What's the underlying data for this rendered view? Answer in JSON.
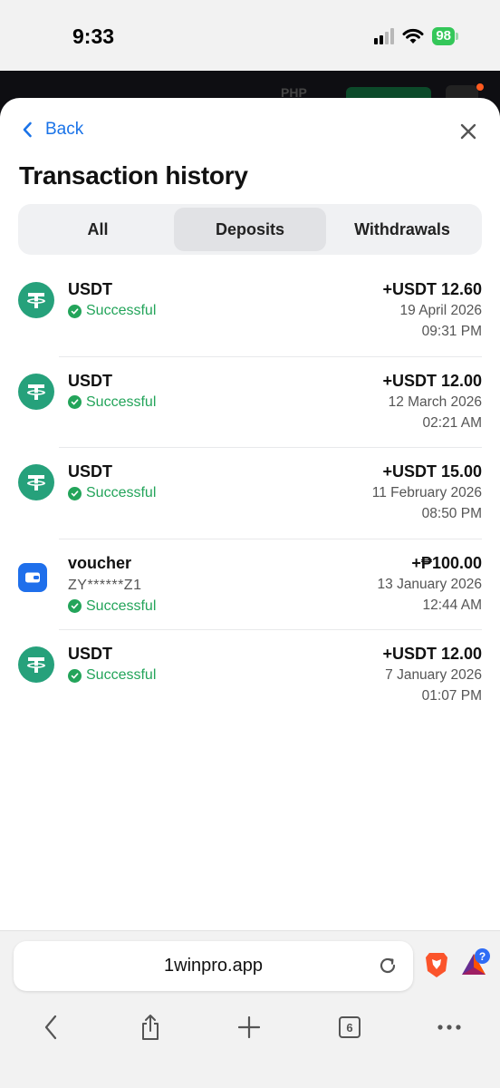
{
  "status_bar": {
    "time": "9:33",
    "battery": "98"
  },
  "backdrop": {
    "currency": "PHP"
  },
  "header": {
    "back_label": "Back",
    "title": "Transaction history"
  },
  "tabs": [
    {
      "label": "All",
      "active": false
    },
    {
      "label": "Deposits",
      "active": true
    },
    {
      "label": "Withdrawals",
      "active": false
    }
  ],
  "transactions": [
    {
      "name": "USDT",
      "icon": "tether-icon",
      "status": "Successful",
      "amount": "+USDT 12.60",
      "date": "19 April 2026",
      "time": "09:31 PM"
    },
    {
      "name": "USDT",
      "icon": "tether-icon",
      "status": "Successful",
      "amount": "+USDT 12.00",
      "date": "12 March 2026",
      "time": "02:21 AM"
    },
    {
      "name": "USDT",
      "icon": "tether-icon",
      "status": "Successful",
      "amount": "+USDT 15.00",
      "date": "11 February 2026",
      "time": "08:50 PM"
    },
    {
      "name": "voucher",
      "icon": "wallet-icon",
      "code": "ZY******Z1",
      "status": "Successful",
      "amount": "+₱100.00",
      "date": "13 January 2026",
      "time": "12:44 AM"
    },
    {
      "name": "USDT",
      "icon": "tether-icon",
      "status": "Successful",
      "amount": "+USDT 12.00",
      "date": "7 January 2026",
      "time": "01:07 PM"
    }
  ],
  "browser": {
    "url": "1winpro.app",
    "tab_count": "6",
    "badge": "?"
  },
  "colors": {
    "accent": "#1a73e8",
    "success": "#23a45a",
    "tether": "#26a17b"
  }
}
